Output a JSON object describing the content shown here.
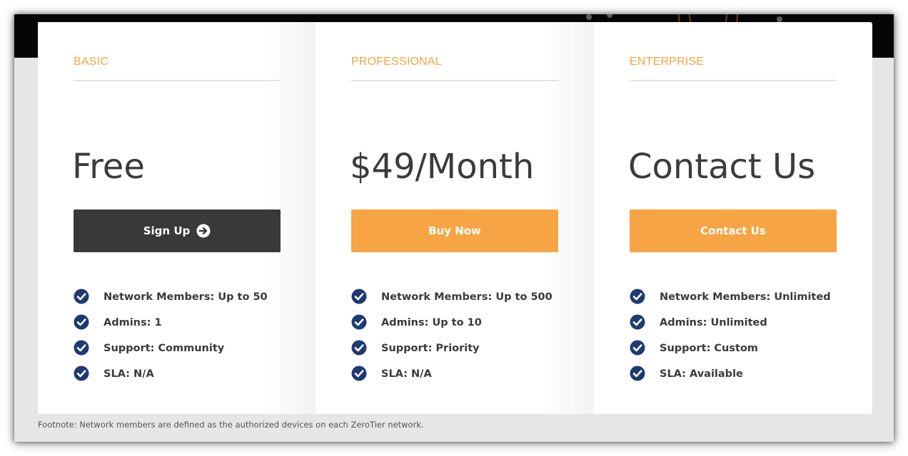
{
  "colors": {
    "accent": "#f5a340",
    "button_orange": "#f7a444",
    "button_dark": "#393939",
    "check_icon": "#1e3a73",
    "header_strip": "#050505",
    "page_background": "#e6e6e6"
  },
  "plans": [
    {
      "tier": "BASIC",
      "price": "Free",
      "cta_label": "Sign Up",
      "cta_icon": "arrow-circle-right-icon",
      "features": [
        "Network Members: Up to 50",
        "Admins: 1",
        "Support: Community",
        "SLA: N/A"
      ]
    },
    {
      "tier": "PROFESSIONAL",
      "price": "$49/Month",
      "cta_label": "Buy Now",
      "features": [
        "Network Members: Up to 500",
        "Admins: Up to 10",
        "Support: Priority",
        "SLA: N/A"
      ]
    },
    {
      "tier": "ENTERPRISE",
      "price": "Contact Us",
      "cta_label": "Contact Us",
      "features": [
        "Network Members: Unlimited",
        "Admins: Unlimited",
        "Support: Custom",
        "SLA: Available"
      ]
    }
  ],
  "footnote": "Footnote: Network members are defined as the authorized devices on each ZeroTier network.",
  "feature_icon": "check-circle-icon"
}
